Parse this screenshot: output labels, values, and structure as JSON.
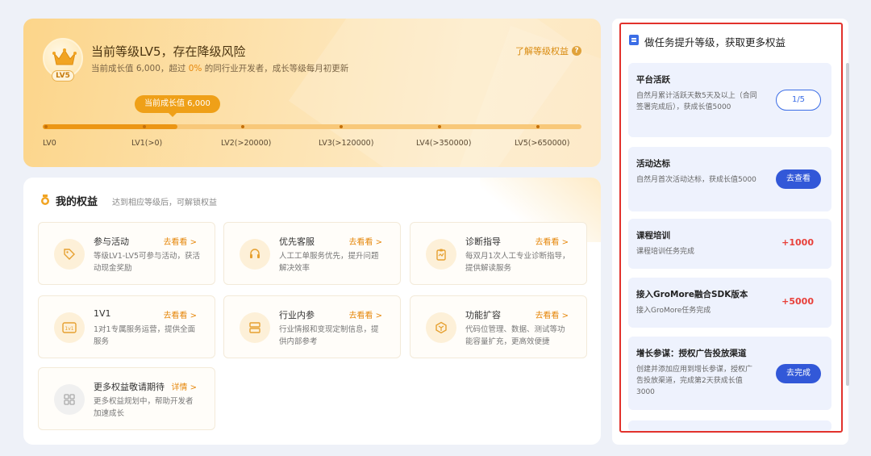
{
  "level": {
    "badge": "LV5",
    "title": "当前等级LV5，存在降级风险",
    "subtitle_prefix": "当前成长值 6,000，超过 ",
    "subtitle_highlight": "0%",
    "subtitle_suffix": " 的同行业开发者，成长等级每月初更新",
    "learn_more": "了解等级权益",
    "growth_pill": "当前成长值 6,000",
    "progress_fraction": 0.25,
    "levels": [
      "LV0",
      "LV1(>0)",
      "LV2(>20000)",
      "LV3(>120000)",
      "LV4(>350000)",
      "LV5(>650000)"
    ]
  },
  "benefits": {
    "title": "我的权益",
    "subtitle": "达到相应等级后，可解锁权益",
    "items": [
      {
        "name": "参与活动",
        "link": "去看看 >",
        "desc": "等级LV1-LV5可参与活动，获活动现金奖励",
        "icon": "tag-icon"
      },
      {
        "name": "优先客服",
        "link": "去看看 >",
        "desc": "人工工单服务优先，提升问题解决效率",
        "icon": "headset-icon"
      },
      {
        "name": "诊断指导",
        "link": "去看看 >",
        "desc": "每双月1次人工专业诊断指导，提供解读服务",
        "icon": "clipboard-icon"
      },
      {
        "name": "1V1",
        "link": "去看看 >",
        "desc": "1对1专属服务运营，提供全面服务",
        "icon": "1v1-icon"
      },
      {
        "name": "行业内参",
        "link": "去看看 >",
        "desc": "行业情报和变现定制信息，提供内部参考",
        "icon": "document-stack-icon"
      },
      {
        "name": "功能扩容",
        "link": "去看看 >",
        "desc": "代码位管理、数据、测试等功能容量扩充，更高效便捷",
        "icon": "box-icon"
      },
      {
        "name": "更多权益敬请期待",
        "link": "详情 >",
        "desc": "更多权益规划中，帮助开发者加速成长",
        "icon": "grid-icon"
      }
    ]
  },
  "tasks": {
    "title": "做任务提升等级，获取更多权益",
    "items": [
      {
        "name": "平台活跃",
        "desc": "自然月累计活跃天数5天及以上（合同签署完成后），获成长值5000",
        "action": "1/5",
        "action_type": "outline"
      },
      {
        "name": "活动达标",
        "desc": "自然月首次活动达标，获成长值5000",
        "action": "去查看",
        "action_type": "solid"
      },
      {
        "name": "课程培训",
        "desc": "课程培训任务完成",
        "action": "+1000",
        "action_type": "points"
      },
      {
        "name": "接入GroMore融合SDK版本",
        "desc": "接入GroMore任务完成",
        "action": "+5000",
        "action_type": "points"
      },
      {
        "name": "增长参谋：授权广告投放渠道",
        "desc": "创建并添加应用到增长参谋，授权广告投放渠道，完成第2天获成长值3000",
        "action": "去完成",
        "action_type": "solid"
      }
    ]
  },
  "colors": {
    "accent_orange": "#ec9614",
    "accent_blue": "#3258d8",
    "highlight_red": "#e2322c",
    "points_red": "#e8403a"
  }
}
